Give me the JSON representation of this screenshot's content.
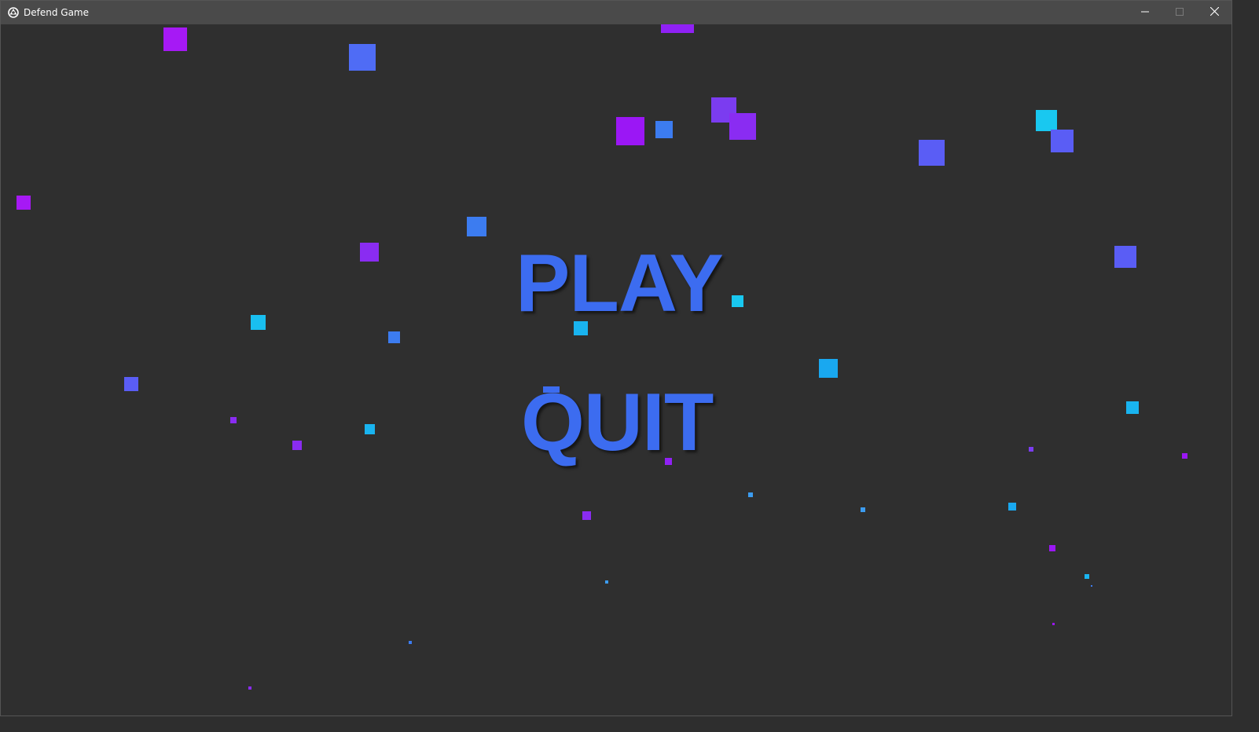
{
  "window": {
    "title": "Defend Game",
    "app_icon": "unity-icon",
    "controls": {
      "minimize_icon": "minimize-icon",
      "maximize_icon": "maximize-icon",
      "close_icon": "close-icon"
    }
  },
  "menu": {
    "play_label": "PLAY",
    "quit_label": "QUIT",
    "text_color": "#3c6cf0"
  },
  "colors": {
    "background": "#2f2f2f",
    "titlebar": "#4a4a4a",
    "particle_purple": "#9b17f5",
    "particle_violet": "#7b3cf0",
    "particle_indigo": "#5a5df5",
    "particle_blue": "#3c7cf0",
    "particle_cyan": "#19c8f0"
  }
}
